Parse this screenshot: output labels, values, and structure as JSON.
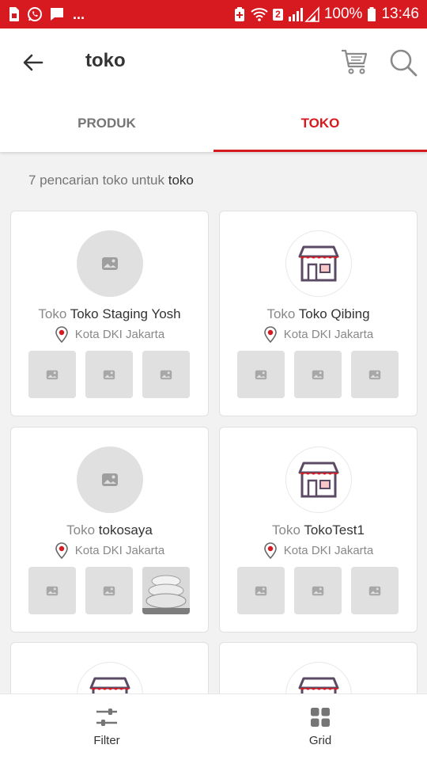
{
  "status_bar": {
    "signal_badge": "2",
    "battery": "100%",
    "time": "13:46",
    "more": "..."
  },
  "header": {
    "title": "toko"
  },
  "tabs": [
    {
      "label": "PRODUK",
      "active": false
    },
    {
      "label": "TOKO",
      "active": true
    }
  ],
  "summary": {
    "prefix": "7 pencarian toko untuk",
    "query": "toko"
  },
  "shops": [
    {
      "prefix": "Toko",
      "name": "Toko Staging Yosh",
      "location": "Kota DKI Jakarta",
      "avatar": "placeholder-image",
      "thumbs": [
        "placeholder-image",
        "placeholder-image",
        "placeholder-image"
      ]
    },
    {
      "prefix": "Toko",
      "name": "Toko Qibing",
      "location": "Kota DKI Jakarta",
      "avatar": "store-logo",
      "thumbs": [
        "placeholder-image",
        "placeholder-image",
        "placeholder-image"
      ]
    },
    {
      "prefix": "Toko",
      "name": "tokosaya",
      "location": "Kota DKI Jakarta",
      "avatar": "placeholder-image",
      "thumbs": [
        "placeholder-image",
        "placeholder-image",
        "pillow-photo"
      ]
    },
    {
      "prefix": "Toko",
      "name": "TokoTest1",
      "location": "Kota DKI Jakarta",
      "avatar": "store-logo",
      "thumbs": [
        "placeholder-image",
        "placeholder-image",
        "placeholder-image"
      ]
    },
    {
      "avatar": "store-logo"
    },
    {
      "avatar": "store-logo"
    }
  ],
  "bottom_bar": {
    "filter_label": "Filter",
    "grid_label": "Grid"
  },
  "colors": {
    "accent": "#d71920",
    "placeholder": "#e0e0e0",
    "text": "#333333",
    "muted": "#888888"
  }
}
